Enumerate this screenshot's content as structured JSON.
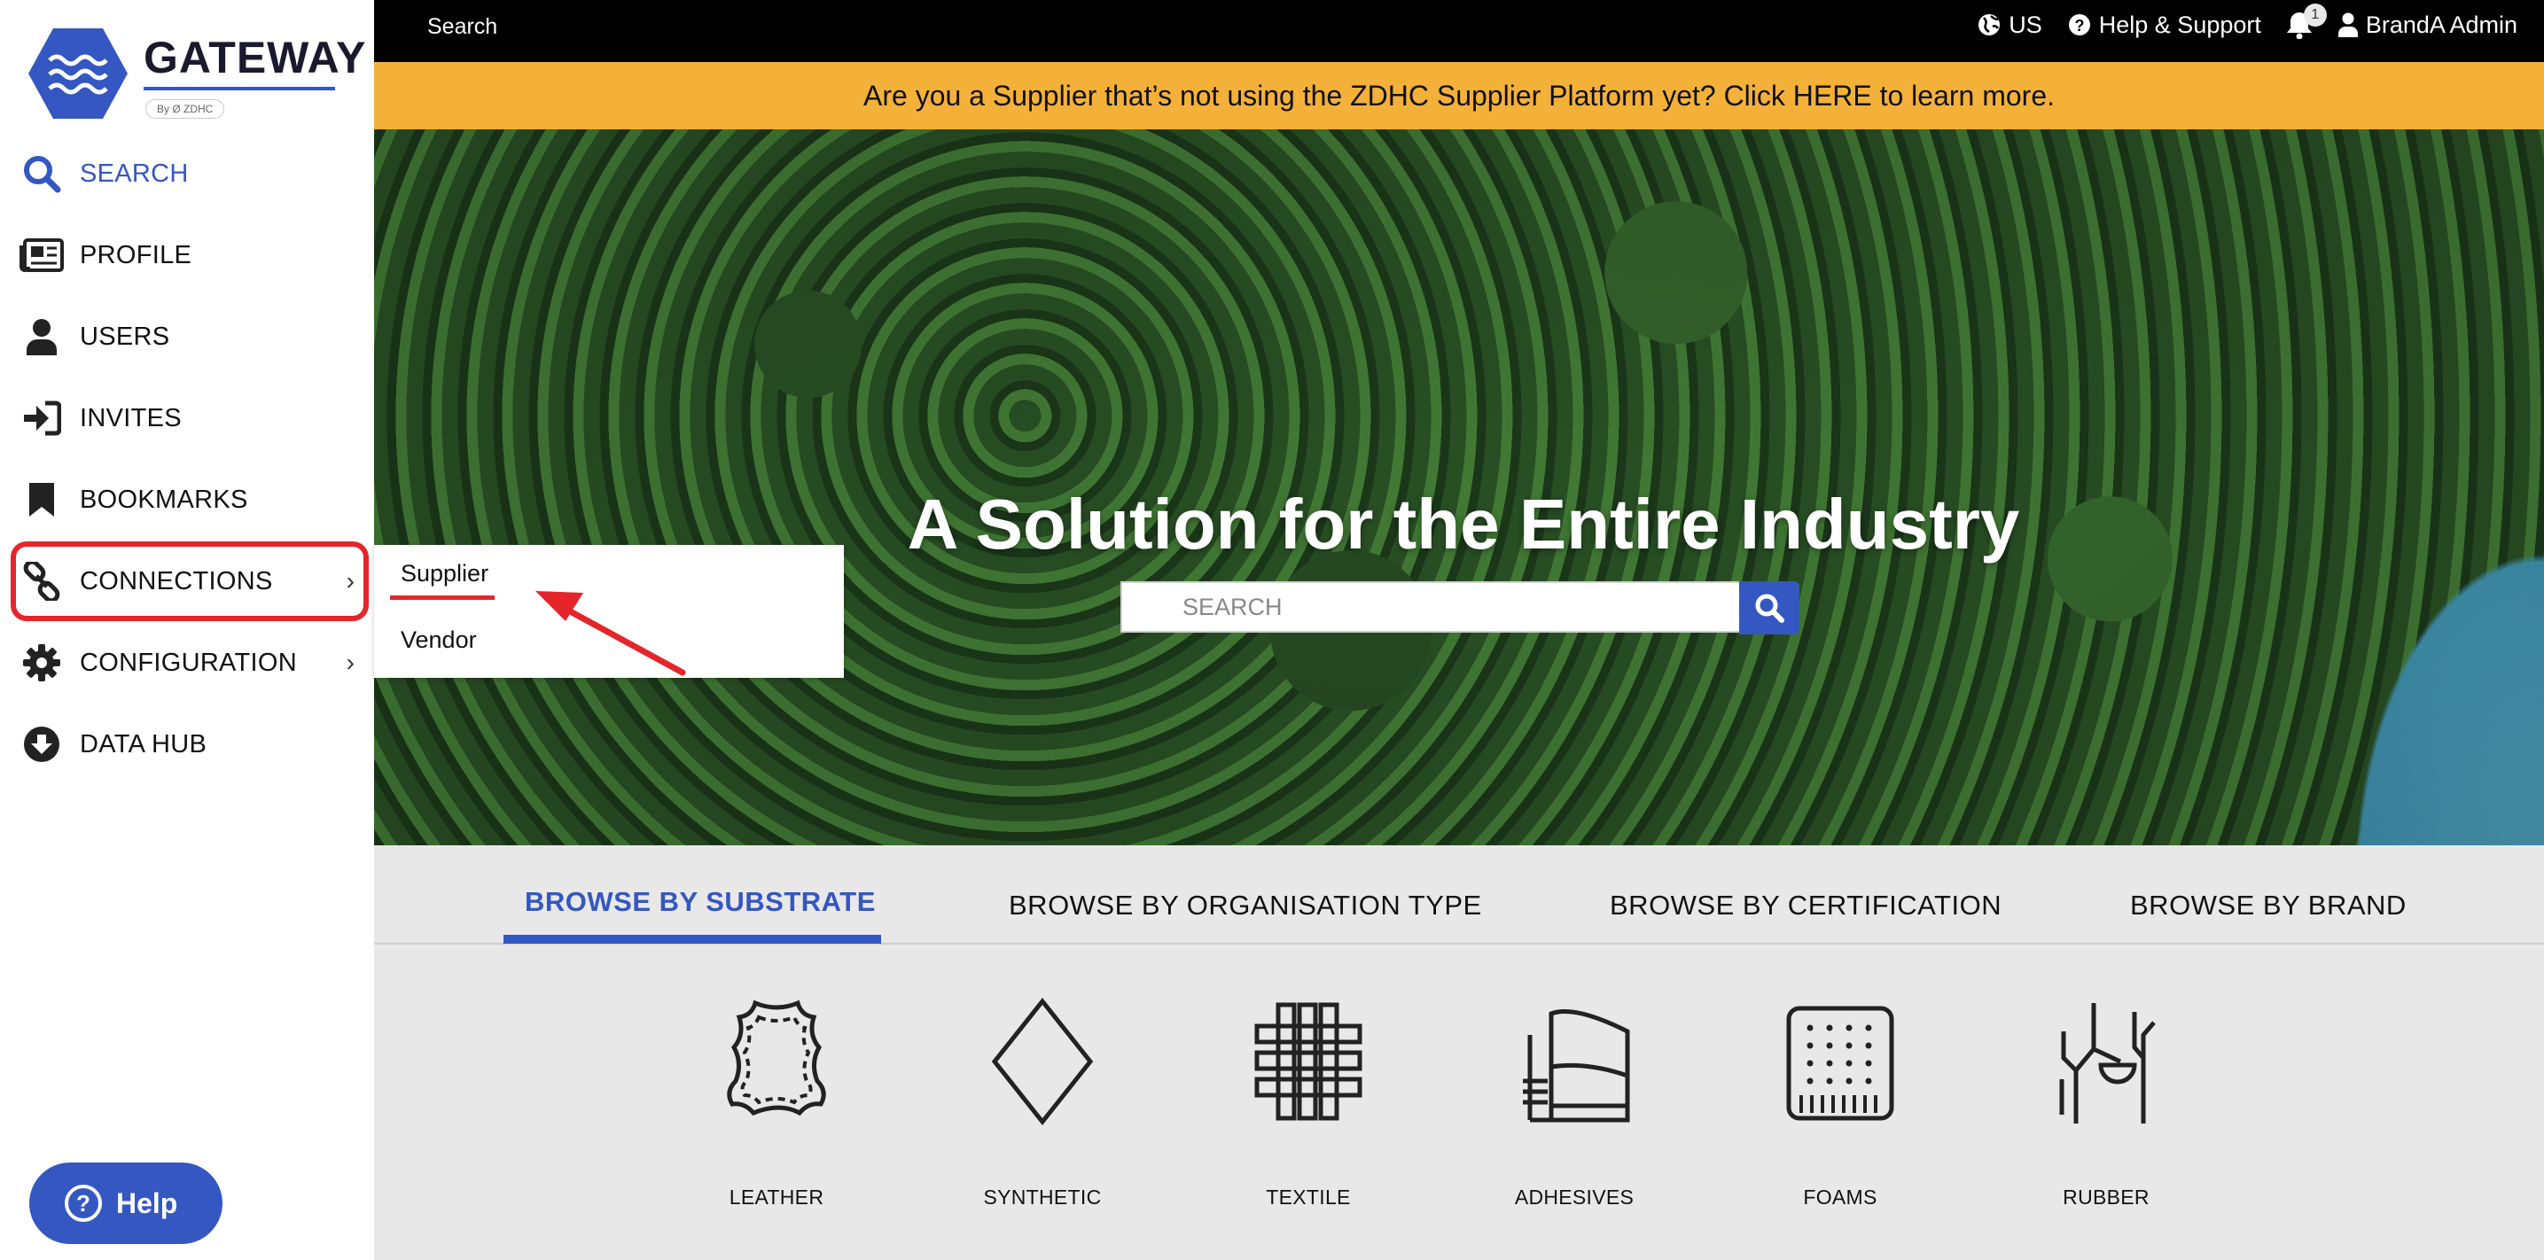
{
  "brand": {
    "name": "GATEWAY",
    "tagline": "By Ø ZDHC"
  },
  "sidebar": {
    "items": [
      {
        "label": "SEARCH",
        "icon": "search-icon",
        "active": true
      },
      {
        "label": "PROFILE",
        "icon": "newspaper-icon"
      },
      {
        "label": "USERS",
        "icon": "user-icon"
      },
      {
        "label": "INVITES",
        "icon": "sign-in-icon"
      },
      {
        "label": "BOOKMARKS",
        "icon": "bookmark-icon"
      },
      {
        "label": "CONNECTIONS",
        "icon": "link-icon",
        "chevron": "›"
      },
      {
        "label": "CONFIGURATION",
        "icon": "gear-icon",
        "chevron": "›"
      },
      {
        "label": "DATA HUB",
        "icon": "download-circle-icon"
      }
    ],
    "help_label": "Help"
  },
  "topbar": {
    "search_label": "Search",
    "region": "US",
    "support": "Help & Support",
    "notification_count": "1",
    "user": "BrandA Admin"
  },
  "banner": {
    "text": "Are you a Supplier that’s not using the ZDHC Supplier Platform yet? Click HERE to learn more."
  },
  "hero": {
    "title": "A Solution for the Entire Industry",
    "search_placeholder": "SEARCH"
  },
  "dropdown": {
    "items": [
      "Supplier",
      "Vendor"
    ]
  },
  "browse": {
    "tabs": [
      "BROWSE BY SUBSTRATE",
      "BROWSE BY ORGANISATION TYPE",
      "BROWSE BY CERTIFICATION",
      "BROWSE BY BRAND"
    ],
    "active_tab": "BROWSE BY SUBSTRATE",
    "substrates": [
      "LEATHER",
      "SYNTHETIC",
      "TEXTILE",
      "ADHESIVES",
      "FOAMS",
      "RUBBER"
    ]
  },
  "colors": {
    "accent": "#3457c2",
    "banner": "#f4b13a",
    "annotation": "#e4262b",
    "topbar": "#000000"
  }
}
